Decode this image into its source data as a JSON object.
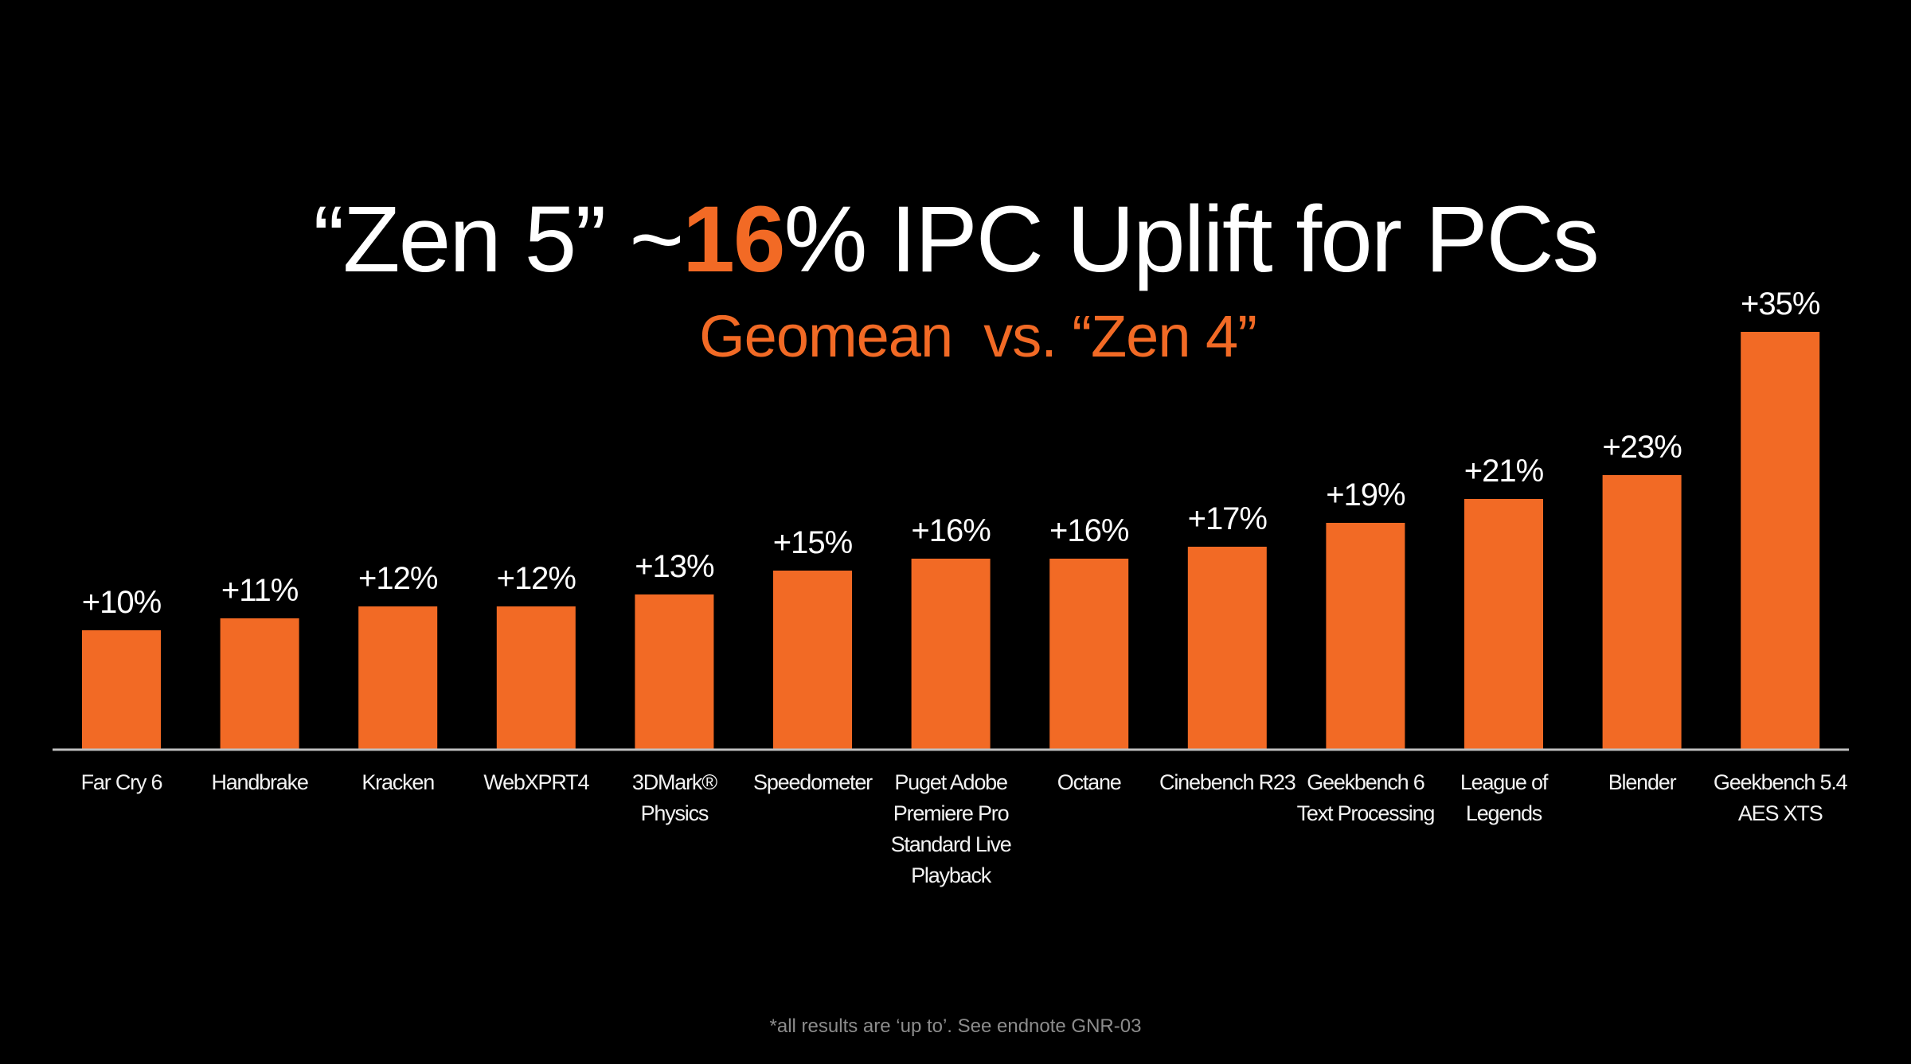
{
  "slide": {
    "title_prefix": "“Zen 5” ~",
    "title_highlight": "16",
    "title_suffix": "% IPC Uplift for PCs",
    "subtitle": "Geomean  vs. “Zen 4”",
    "footnote": "*all results are ‘up to’. See endnote GNR-03"
  },
  "colors": {
    "background": "#000000",
    "bar": "#F26A25",
    "accent": "#F26A25",
    "text": "#FFFFFF",
    "axis": "#BFBFBF",
    "footnote": "#8C8C8C"
  },
  "chart_data": {
    "type": "bar",
    "title": "“Zen 5” ~16% IPC Uplift for PCs",
    "subtitle": "Geomean  vs. “Zen 4”",
    "xlabel": "",
    "ylabel": "",
    "ylim": [
      0,
      35
    ],
    "grid": false,
    "legend": "none",
    "y_axis_visible": false,
    "categories": [
      [
        "Far Cry 6"
      ],
      [
        "Handbrake"
      ],
      [
        "Kracken"
      ],
      [
        "WebXPRT4"
      ],
      [
        "3DMark®",
        "Physics"
      ],
      [
        "Speedometer"
      ],
      [
        "Puget Adobe",
        "Premiere Pro",
        "Standard Live",
        "Playback"
      ],
      [
        "Octane"
      ],
      [
        "Cinebench R23"
      ],
      [
        "Geekbench 6",
        "Text Processing"
      ],
      [
        "League of",
        "Legends"
      ],
      [
        "Blender"
      ],
      [
        "Geekbench 5.4",
        "AES XTS"
      ]
    ],
    "values": [
      10,
      11,
      12,
      12,
      13,
      15,
      16,
      16,
      17,
      19,
      21,
      23,
      35
    ],
    "data_labels": [
      "+10%",
      "+11%",
      "+12%",
      "+12%",
      "+13%",
      "+15%",
      "+16%",
      "+16%",
      "+17%",
      "+19%",
      "+21%",
      "+23%",
      "+35%"
    ],
    "units": "% IPC uplift vs. Zen 4",
    "annotation": "*all results are ‘up to’. See endnote GNR-03"
  }
}
